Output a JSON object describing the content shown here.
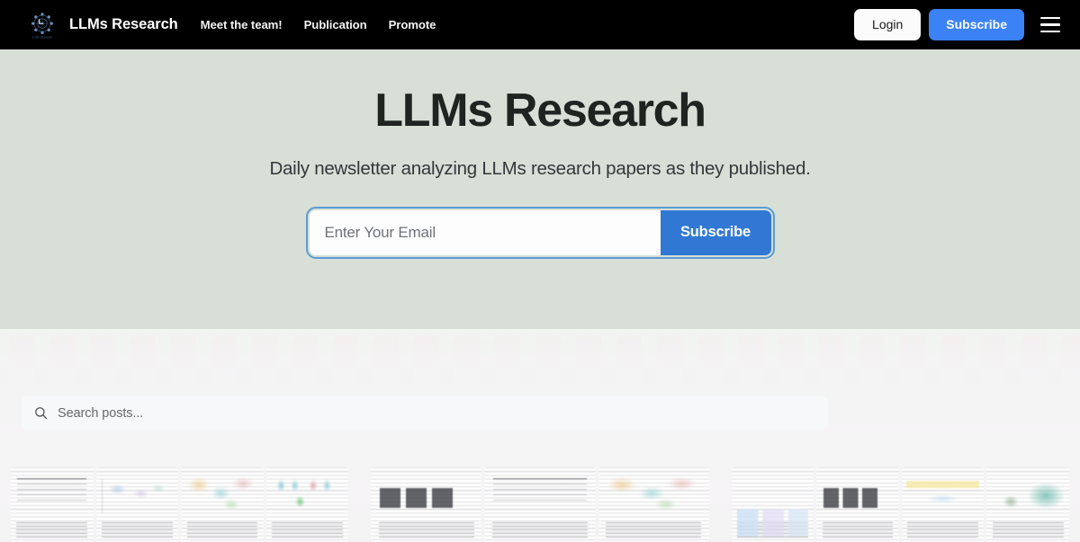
{
  "header": {
    "brand_name": "LLMs Research",
    "logo_icon": "gear-network-logo-icon",
    "nav": [
      {
        "label": "Meet the team!"
      },
      {
        "label": "Publication"
      },
      {
        "label": "Promote"
      }
    ],
    "login_label": "Login",
    "subscribe_label": "Subscribe",
    "menu_icon": "hamburger-menu-icon",
    "background_color": "#000000"
  },
  "hero": {
    "title": "LLMs Research",
    "subtitle": "Daily newsletter analyzing LLMs research papers as they published.",
    "background_color": "#d7dfd7",
    "form": {
      "email_placeholder": "Enter Your Email",
      "email_value": "",
      "submit_label": "Subscribe",
      "submit_color": "#3178d4",
      "focus_ring_color": "#5b9bd5"
    }
  },
  "search": {
    "placeholder": "Search posts...",
    "value": "",
    "icon": "search-icon"
  },
  "thumbnails": {
    "groups": [
      {
        "items": [
          {
            "kind": "equations-page",
            "style": "thumb-a"
          },
          {
            "kind": "flow-diagram-page",
            "style": "thumb-diagram"
          },
          {
            "kind": "architecture-diagram-page",
            "style": "thumb-colorful"
          },
          {
            "kind": "illustrated-figure-page",
            "style": "thumb-people"
          }
        ]
      },
      {
        "items": [
          {
            "kind": "pipeline-diagram-page",
            "style": "thumb-dark"
          },
          {
            "kind": "results-table-page",
            "style": "thumb-a"
          },
          {
            "kind": "benchmark-figure-page",
            "style": "thumb-colorful"
          }
        ]
      },
      {
        "items": [
          {
            "kind": "algorithm-listing-page",
            "style": "thumb-blue"
          },
          {
            "kind": "tree-diagram-page",
            "style": "thumb-dark"
          },
          {
            "kind": "highlighted-text-page",
            "style": "thumb-yellow"
          },
          {
            "kind": "cloud-diagram-page",
            "style": "thumb-green"
          }
        ]
      }
    ]
  },
  "ghost_strip": {
    "count": 40
  }
}
